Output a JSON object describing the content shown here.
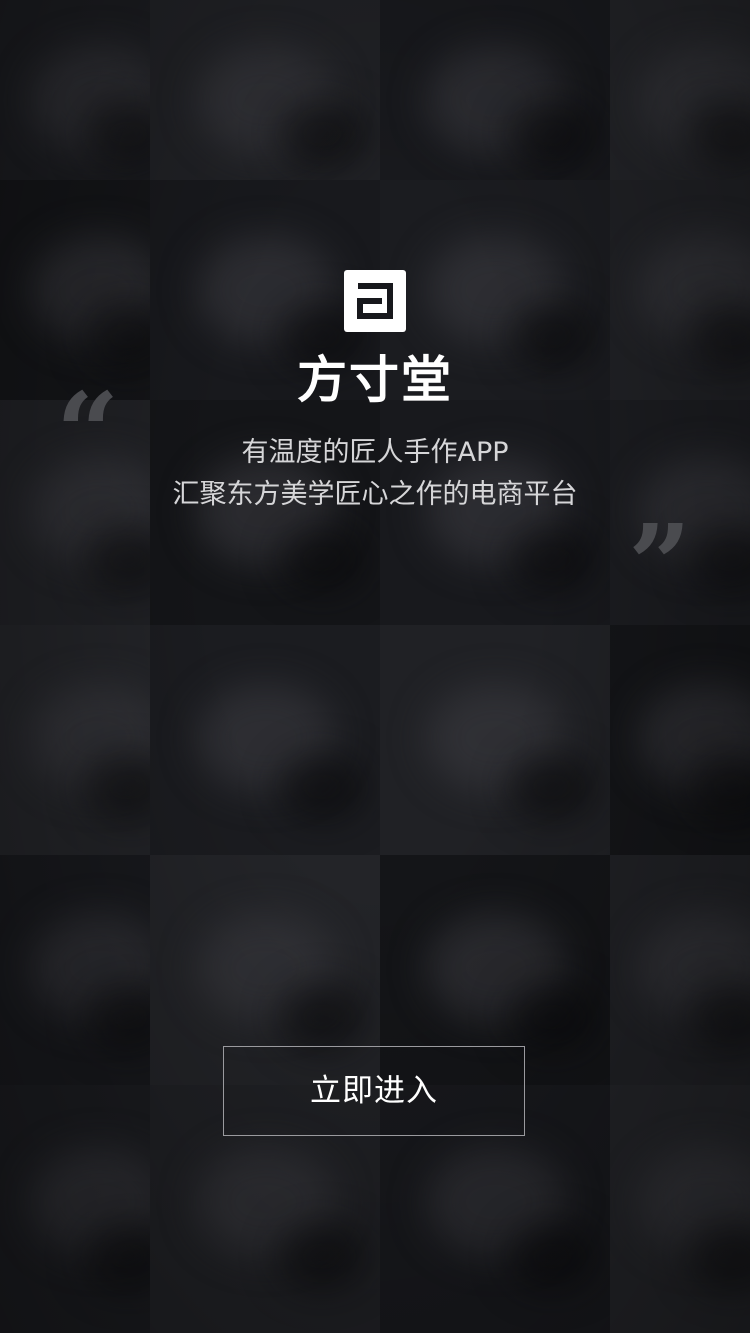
{
  "brand": {
    "name": "方寸堂",
    "logo_icon": "fangcuntang-logo-icon",
    "quote_open": "“",
    "quote_close": "”"
  },
  "tagline": {
    "line1": "有温度的匠人手作APP",
    "line2": "汇聚东方美学匠心之作的电商平台"
  },
  "actions": {
    "enter_label": "立即进入"
  },
  "colors": {
    "background": "#17181c",
    "text_primary": "#ffffff",
    "text_secondary": "#d6d6d8",
    "quote_mark": "#4a4b4f",
    "button_border": "#9a9a9e"
  }
}
